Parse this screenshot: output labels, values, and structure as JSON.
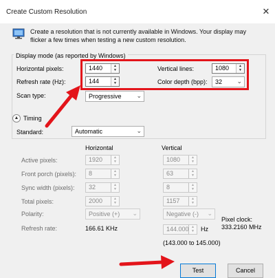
{
  "window": {
    "title": "Create Custom Resolution",
    "close_glyph": "✕"
  },
  "description": "Create a resolution that is not currently available in Windows. Your display may flicker a few times when testing a new custom resolution.",
  "display_mode": {
    "group_label": "Display mode (as reported by Windows)",
    "horizontal_pixels": {
      "label": "Horizontal pixels:",
      "value": "1440"
    },
    "vertical_lines": {
      "label": "Vertical lines:",
      "value": "1080"
    },
    "refresh_rate": {
      "label": "Refresh rate (Hz):",
      "value": "144"
    },
    "color_depth": {
      "label": "Color depth (bpp):",
      "value": "32"
    },
    "scan_type": {
      "label": "Scan type:",
      "value": "Progressive"
    }
  },
  "timing": {
    "label": "Timing",
    "standard": {
      "label": "Standard:",
      "value": "Automatic"
    },
    "horizontal_header": "Horizontal",
    "vertical_header": "Vertical",
    "active_pixels": {
      "label": "Active pixels:",
      "h": "1920",
      "v": "1080"
    },
    "front_porch": {
      "label": "Front porch (pixels):",
      "h": "8",
      "v": "63"
    },
    "sync_width": {
      "label": "Sync width (pixels):",
      "h": "32",
      "v": "8"
    },
    "total_pixels": {
      "label": "Total pixels:",
      "h": "2000",
      "v": "1157"
    },
    "polarity": {
      "label": "Polarity:",
      "h": "Positive (+)",
      "v": "Negative (-)"
    },
    "refresh_rate": {
      "label": "Refresh rate:",
      "h": "166.61 KHz",
      "v": "144.000",
      "unit": "Hz",
      "range": "(143.000 to 145.000)"
    },
    "pixel_clock": {
      "label": "Pixel clock:",
      "value": "333.2160 MHz"
    }
  },
  "buttons": {
    "test": "Test",
    "cancel": "Cancel"
  },
  "colors": {
    "highlight": "#e3141a",
    "dialog_bg": "#f0f0f0"
  },
  "icons": {
    "monitor": "monitor-icon",
    "collapse": "collapse-arrow-icon",
    "chevron": "chevron-down-icon",
    "spin": "spin-arrows-icon"
  }
}
